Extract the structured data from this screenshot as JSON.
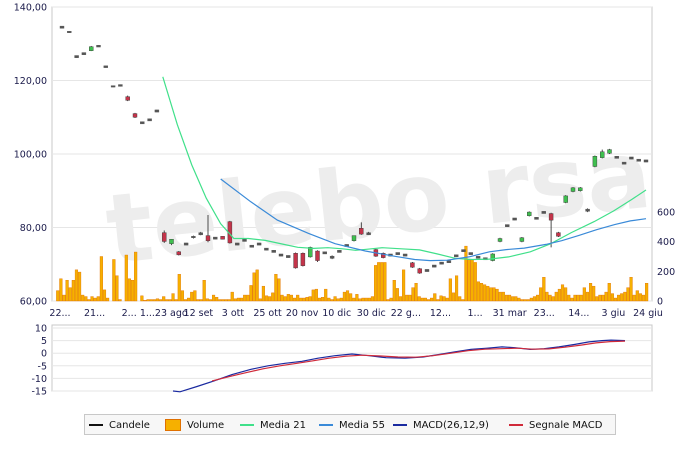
{
  "watermark": "telebo rsa",
  "chart_data": {
    "type": "candlestick",
    "price_axis": {
      "ylim": [
        60,
        140
      ],
      "ticks": [
        "140,00",
        "120,00",
        "100,00",
        "80,00",
        "60,00"
      ]
    },
    "volume_axis": {
      "ylim": [
        0,
        600
      ],
      "ticks": [
        "600",
        "400",
        "200",
        "0"
      ]
    },
    "x_ticks": [
      "22...",
      "21...",
      "2...",
      "1...23 ago",
      "12 set",
      "3 ott",
      "25 ott",
      "20 nov",
      "10 dic",
      "30 dic",
      "22 g...",
      "12...",
      "1...",
      "31 mar",
      "23...",
      "14...",
      "3 giu",
      "24 giu"
    ],
    "macd_axis": {
      "ylim": [
        -15,
        10
      ],
      "ticks": [
        "10",
        "5",
        "0",
        "-5",
        "-10",
        "-15"
      ]
    },
    "candles": [
      [
        134.8,
        134.2,
        134.8,
        134.2,
        1
      ],
      [
        133.4,
        133.0,
        133.4,
        133.0,
        0
      ],
      [
        126.8,
        126.2,
        126.8,
        126.2,
        1
      ],
      [
        127.6,
        127.0,
        127.6,
        127.0,
        0
      ],
      [
        128.1,
        129.2,
        129.4,
        128.0,
        1
      ],
      [
        129.6,
        129.1,
        129.6,
        129.1,
        1
      ],
      [
        124.0,
        123.5,
        124.0,
        123.5,
        0
      ],
      [
        118.6,
        118.2,
        118.6,
        118.2,
        1
      ],
      [
        118.9,
        118.4,
        118.9,
        118.4,
        1
      ],
      [
        115.6,
        114.6,
        115.9,
        114.4,
        1
      ],
      [
        111.0,
        110.0,
        111.2,
        109.8,
        0
      ],
      [
        108.8,
        108.2,
        108.8,
        108.2,
        1
      ],
      [
        109.6,
        109.0,
        109.6,
        109.0,
        1
      ],
      [
        112.0,
        111.4,
        112.0,
        111.4,
        0
      ],
      [
        78.6,
        76.2,
        79.2,
        75.8,
        0
      ],
      [
        75.6,
        76.8,
        76.8,
        75.2,
        1
      ],
      [
        73.4,
        72.6,
        73.6,
        72.4,
        0
      ],
      [
        75.8,
        75.2,
        75.8,
        75.2,
        1
      ],
      [
        77.6,
        77.2,
        77.8,
        77.0,
        1
      ],
      [
        78.6,
        78.0,
        78.8,
        77.9,
        1
      ],
      [
        77.8,
        76.4,
        83.4,
        76.0,
        0
      ],
      [
        77.4,
        76.8,
        77.4,
        76.8,
        1
      ],
      [
        77.6,
        76.8,
        77.6,
        76.8,
        0
      ],
      [
        81.6,
        75.8,
        81.8,
        75.6,
        0
      ],
      [
        75.8,
        75.2,
        75.8,
        75.2,
        1
      ],
      [
        76.8,
        76.2,
        76.8,
        76.2,
        1
      ],
      [
        75.2,
        74.6,
        75.2,
        74.6,
        0
      ],
      [
        75.8,
        75.2,
        75.8,
        75.2,
        1
      ],
      [
        74.4,
        73.8,
        74.4,
        73.8,
        0
      ],
      [
        73.8,
        73.2,
        73.8,
        73.2,
        1
      ],
      [
        72.8,
        72.2,
        72.8,
        72.2,
        0
      ],
      [
        72.4,
        71.8,
        72.4,
        71.8,
        1
      ],
      [
        73.0,
        69.0,
        73.2,
        68.8,
        1
      ],
      [
        73.0,
        69.6,
        73.2,
        69.4,
        0
      ],
      [
        72.0,
        74.6,
        74.8,
        71.8,
        1
      ],
      [
        73.6,
        71.0,
        73.8,
        70.6,
        0
      ],
      [
        73.4,
        72.8,
        73.4,
        72.8,
        1
      ],
      [
        72.2,
        71.6,
        72.4,
        71.4,
        1
      ],
      [
        73.8,
        73.2,
        73.8,
        73.2,
        0
      ],
      [
        75.4,
        74.8,
        75.4,
        74.8,
        1
      ],
      [
        76.4,
        77.8,
        77.8,
        76.2,
        1
      ],
      [
        79.8,
        78.2,
        81.4,
        78.0,
        0
      ],
      [
        78.6,
        78.0,
        78.8,
        78.0,
        1
      ],
      [
        74.0,
        72.2,
        74.2,
        72.0,
        0
      ],
      [
        73.0,
        71.8,
        73.2,
        71.6,
        0
      ],
      [
        72.8,
        72.2,
        72.8,
        72.2,
        1
      ],
      [
        73.2,
        72.6,
        73.2,
        72.6,
        0
      ],
      [
        72.8,
        72.2,
        72.8,
        72.2,
        1
      ],
      [
        70.4,
        69.2,
        70.6,
        69.0,
        0
      ],
      [
        68.8,
        67.6,
        69.0,
        67.4,
        0
      ],
      [
        68.6,
        68.0,
        68.6,
        68.0,
        1
      ],
      [
        69.8,
        69.2,
        69.8,
        69.2,
        0
      ],
      [
        70.6,
        70.0,
        70.6,
        70.0,
        1
      ],
      [
        71.0,
        70.4,
        71.0,
        70.4,
        0
      ],
      [
        72.6,
        72.0,
        72.6,
        72.0,
        1
      ],
      [
        74.0,
        73.4,
        74.0,
        73.4,
        0
      ],
      [
        73.2,
        72.6,
        73.2,
        72.6,
        1
      ],
      [
        72.2,
        71.6,
        72.2,
        71.6,
        0
      ],
      [
        71.8,
        71.2,
        71.8,
        71.2,
        1
      ],
      [
        71.0,
        72.8,
        73.0,
        70.8,
        0
      ],
      [
        76.2,
        77.0,
        77.2,
        76.0,
        1
      ],
      [
        80.8,
        80.2,
        80.8,
        80.2,
        0
      ],
      [
        82.6,
        82.0,
        82.6,
        82.0,
        1
      ],
      [
        76.2,
        77.2,
        77.4,
        76.0,
        1
      ],
      [
        83.2,
        84.2,
        84.4,
        83.0,
        1
      ],
      [
        82.8,
        82.2,
        82.8,
        82.2,
        1
      ],
      [
        84.4,
        83.8,
        84.4,
        83.8,
        0
      ],
      [
        83.8,
        82.0,
        84.0,
        74.6,
        0
      ],
      [
        78.6,
        77.6,
        78.8,
        77.4,
        0
      ],
      [
        86.8,
        88.6,
        88.8,
        86.6,
        1
      ],
      [
        89.8,
        90.8,
        91.0,
        89.6,
        1
      ],
      [
        90.0,
        90.8,
        91.0,
        89.8,
        0
      ],
      [
        84.4,
        85.0,
        85.2,
        84.2,
        1
      ],
      [
        96.6,
        99.4,
        99.6,
        96.4,
        0
      ],
      [
        99.0,
        100.6,
        101.2,
        98.8,
        1
      ],
      [
        100.2,
        101.2,
        101.4,
        100.0,
        0
      ],
      [
        99.4,
        98.8,
        99.4,
        98.8,
        1
      ],
      [
        97.8,
        97.2,
        97.8,
        97.2,
        0
      ],
      [
        99.2,
        98.6,
        99.2,
        98.6,
        1
      ],
      [
        98.6,
        98.0,
        98.6,
        98.0,
        1
      ],
      [
        98.4,
        97.8,
        98.4,
        97.8,
        0
      ]
    ],
    "volume": [
      70,
      150,
      40,
      140,
      90,
      140,
      210,
      195,
      40,
      30,
      10,
      30,
      20,
      30,
      300,
      75,
      20,
      0,
      280,
      170,
      10,
      0,
      310,
      150,
      140,
      330,
      0,
      35,
      5,
      10,
      10,
      10,
      15,
      10,
      30,
      10,
      10,
      50,
      10,
      180,
      70,
      10,
      20,
      60,
      70,
      10,
      10,
      140,
      15,
      10,
      40,
      25,
      10,
      10,
      10,
      10,
      60,
      15,
      20,
      20,
      40,
      40,
      105,
      190,
      210,
      15,
      100,
      35,
      30,
      55,
      180,
      150,
      40,
      30,
      45,
      40,
      20,
      40,
      20,
      20,
      25,
      30,
      75,
      80,
      20,
      25,
      80,
      20,
      10,
      30,
      15,
      20,
      60,
      70,
      50,
      20,
      45,
      15,
      20,
      20,
      20,
      30,
      240,
      260,
      260,
      260,
      10,
      20,
      140,
      85,
      30,
      210,
      40,
      40,
      90,
      120,
      30,
      20,
      20,
      10,
      20,
      50,
      10,
      35,
      30,
      20,
      150,
      55,
      170,
      30,
      10,
      370,
      280,
      280,
      260,
      130,
      120,
      110,
      100,
      90,
      90,
      80,
      60,
      60,
      40,
      40,
      30,
      30,
      20,
      10,
      10,
      10,
      20,
      30,
      40,
      90,
      160,
      60,
      40,
      30,
      60,
      80,
      110,
      90,
      40,
      20,
      40,
      40,
      40,
      90,
      60,
      120,
      100,
      30,
      40,
      40,
      60,
      120,
      50,
      20,
      40,
      50,
      60,
      90,
      160,
      40,
      70,
      50,
      40,
      120
    ],
    "series": [
      {
        "name": "Media 21",
        "points": [
          [
            92,
            121
          ],
          [
            104,
            108
          ],
          [
            116,
            97
          ],
          [
            128,
            88
          ],
          [
            140,
            81
          ],
          [
            151,
            77
          ],
          [
            163,
            77
          ],
          [
            177,
            76.5
          ],
          [
            191,
            75.5
          ],
          [
            204,
            74.6
          ],
          [
            217,
            74.3
          ],
          [
            229,
            74.5
          ],
          [
            241,
            74.2
          ],
          [
            252,
            73.8
          ],
          [
            262,
            74.1
          ],
          [
            274,
            74.5
          ],
          [
            290,
            74.2
          ],
          [
            305,
            73.9
          ],
          [
            320,
            72.8
          ],
          [
            335,
            71.6
          ],
          [
            349,
            71.3
          ],
          [
            363,
            71.4
          ],
          [
            379,
            72.0
          ],
          [
            397,
            73.4
          ],
          [
            414,
            75.6
          ],
          [
            431,
            78.6
          ],
          [
            450,
            81.6
          ],
          [
            466,
            84.5
          ],
          [
            481,
            87.6
          ],
          [
            493,
            90.2
          ]
        ]
      },
      {
        "name": "Media 55",
        "points": [
          [
            140,
            93.2
          ],
          [
            165,
            87
          ],
          [
            187,
            82
          ],
          [
            213,
            78.4
          ],
          [
            235,
            75.6
          ],
          [
            260,
            73.6
          ],
          [
            284,
            72.2
          ],
          [
            301,
            71.3
          ],
          [
            314,
            71.0
          ],
          [
            328,
            71.1
          ],
          [
            346,
            72.0
          ],
          [
            363,
            73.4
          ],
          [
            377,
            74.0
          ],
          [
            392,
            74.4
          ],
          [
            410,
            75.4
          ],
          [
            423,
            76.4
          ],
          [
            437,
            77.8
          ],
          [
            452,
            79.4
          ],
          [
            467,
            80.8
          ],
          [
            480,
            81.8
          ],
          [
            493,
            82.4
          ]
        ]
      },
      {
        "name": "MACD(26,12,9)",
        "points": [
          [
            173,
            -15
          ],
          [
            180,
            -15.3
          ],
          [
            197,
            -13.2
          ],
          [
            214,
            -11
          ],
          [
            232,
            -8.5
          ],
          [
            251,
            -6.4
          ],
          [
            268,
            -5
          ],
          [
            285,
            -4
          ],
          [
            302,
            -3.2
          ],
          [
            318,
            -2
          ],
          [
            335,
            -1
          ],
          [
            352,
            -0.3
          ],
          [
            369,
            -1
          ],
          [
            386,
            -1.8
          ],
          [
            405,
            -2
          ],
          [
            423,
            -1.5
          ],
          [
            439,
            -0.5
          ],
          [
            455,
            0.5
          ],
          [
            471,
            1.5
          ],
          [
            487,
            2
          ],
          [
            502,
            2.5
          ],
          [
            515,
            2.2
          ],
          [
            530,
            1.5
          ],
          [
            544,
            1.8
          ],
          [
            559,
            2.5
          ],
          [
            575,
            3.5
          ],
          [
            589,
            4.5
          ],
          [
            602,
            5
          ],
          [
            611,
            5.2
          ],
          [
            625,
            5
          ]
        ]
      },
      {
        "name": "Segnale MACD",
        "points": [
          [
            212,
            -11
          ],
          [
            230,
            -9.2
          ],
          [
            247,
            -7.6
          ],
          [
            263,
            -6.2
          ],
          [
            280,
            -5
          ],
          [
            297,
            -4
          ],
          [
            313,
            -3
          ],
          [
            329,
            -2
          ],
          [
            346,
            -1.2
          ],
          [
            362,
            -0.8
          ],
          [
            381,
            -1.1
          ],
          [
            398,
            -1.5
          ],
          [
            416,
            -1.6
          ],
          [
            433,
            -1.0
          ],
          [
            451,
            0
          ],
          [
            468,
            1
          ],
          [
            485,
            1.6
          ],
          [
            501,
            1.8
          ],
          [
            517,
            2
          ],
          [
            533,
            1.6
          ],
          [
            549,
            1.7
          ],
          [
            565,
            2.4
          ],
          [
            581,
            3.2
          ],
          [
            596,
            4.1
          ],
          [
            610,
            4.6
          ],
          [
            625,
            4.8
          ]
        ]
      }
    ],
    "legend": [
      "Candele",
      "Volume",
      "Media 21",
      "Media 55",
      "MACD(26,12,9)",
      "Segnale MACD"
    ],
    "legend_colors": {
      "Candele": "#111111",
      "Volume": "#f6b000",
      "Media 21": "#40e08a",
      "Media 55": "#3a8ad8",
      "MACD(26,12,9)": "#1a2aa0",
      "Segnale MACD": "#d02a3a"
    },
    "candle_colors": {
      "up": "#3fbf4f",
      "down": "#c4344a"
    },
    "volume_colors": {
      "fill": "#f6b000",
      "stroke": "#e07000"
    }
  }
}
